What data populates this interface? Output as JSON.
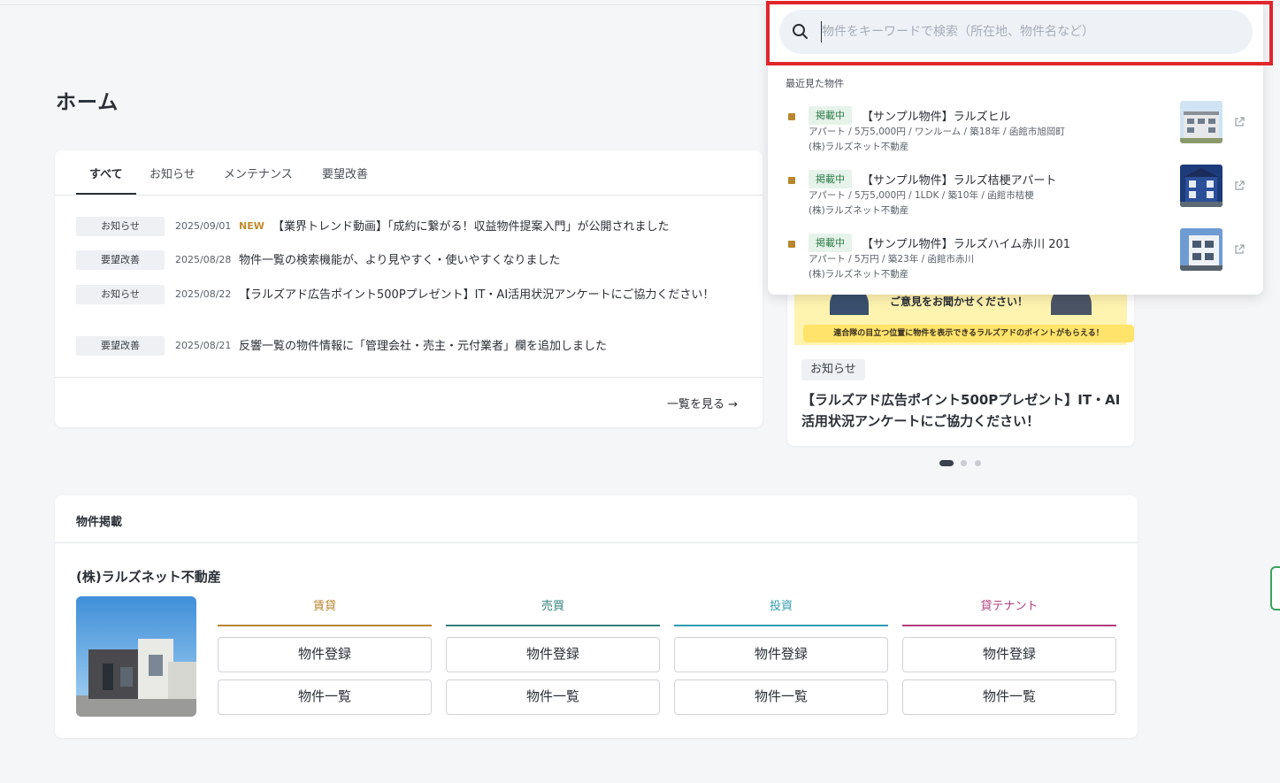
{
  "page": {
    "title": "ホーム"
  },
  "news": {
    "tabs": [
      {
        "label": "すべて"
      },
      {
        "label": "お知らせ"
      },
      {
        "label": "メンテナンス"
      },
      {
        "label": "要望改善"
      }
    ],
    "items": [
      {
        "category": "お知らせ",
        "date": "2025/09/01",
        "new_label": "NEW",
        "title": "【業界トレンド動画】「成約に繋がる！収益物件提案入門」が公開されました"
      },
      {
        "category": "要望改善",
        "date": "2025/08/28",
        "new_label": "",
        "title": "物件一覧の検索機能が、より見やすく・使いやすくなりました"
      },
      {
        "category": "お知らせ",
        "date": "2025/08/22",
        "new_label": "",
        "title": "【ラルズアド広告ポイント500Pプレゼント】IT・AI活用状況アンケートにご協力ください！"
      },
      {
        "category": "要望改善",
        "date": "2025/08/21",
        "new_label": "",
        "title": "反響一覧の物件情報に「管理会社・売主・元付業者」欄を追加しました"
      }
    ],
    "see_all": "一覧を見る →"
  },
  "banner": {
    "image_text": "ご意見をお聞かせください！",
    "image_strip": "連合隊の目立つ位置に物件を表示できるラルズアドのポイントがもらえる！",
    "category": "お知らせ",
    "title": "【ラルズアド広告ポイント500Pプレゼント】IT・AI活用状況アンケートにご協力ください！",
    "dots": 3,
    "active_dot": 0
  },
  "property": {
    "header": "物件掲載",
    "company": "(株)ラルズネット不動産",
    "columns": [
      {
        "label": "賃貸",
        "color": "#b8862f",
        "register": "物件登録",
        "list": "物件一覧"
      },
      {
        "label": "売買",
        "color": "#2f7f7a",
        "register": "物件登録",
        "list": "物件一覧"
      },
      {
        "label": "投資",
        "color": "#2f9bb0",
        "register": "物件登録",
        "list": "物件一覧"
      },
      {
        "label": "貸テナント",
        "color": "#b0407e",
        "register": "物件登録",
        "list": "物件一覧"
      }
    ]
  },
  "search": {
    "placeholder": "物件をキーワードで検索（所在地、物件名など）",
    "value": "",
    "recent_label": "最近見た物件",
    "recent": [
      {
        "status": "掲載中",
        "title": "【サンプル物件】ラルズヒル",
        "meta": "アパート / 5万5,000円 / ワンルーム / 築18年 / 函館市旭岡町",
        "company": "(株)ラルズネット不動産"
      },
      {
        "status": "掲載中",
        "title": "【サンプル物件】ラルズ桔梗アパート",
        "meta": "アパート / 5万5,000円 / 1LDK / 築10年 / 函館市桔梗",
        "company": "(株)ラルズネット不動産"
      },
      {
        "status": "掲載中",
        "title": "【サンプル物件】ラルズハイム赤川 201",
        "meta": "アパート / 5万円 / 築23年 / 函館市赤川",
        "company": "(株)ラルズネット不動産"
      }
    ]
  },
  "colors": {
    "highlight": "#e0262b",
    "status_green": "#2c7a46",
    "marker": "#b8862f",
    "new": "#c18b2e"
  }
}
